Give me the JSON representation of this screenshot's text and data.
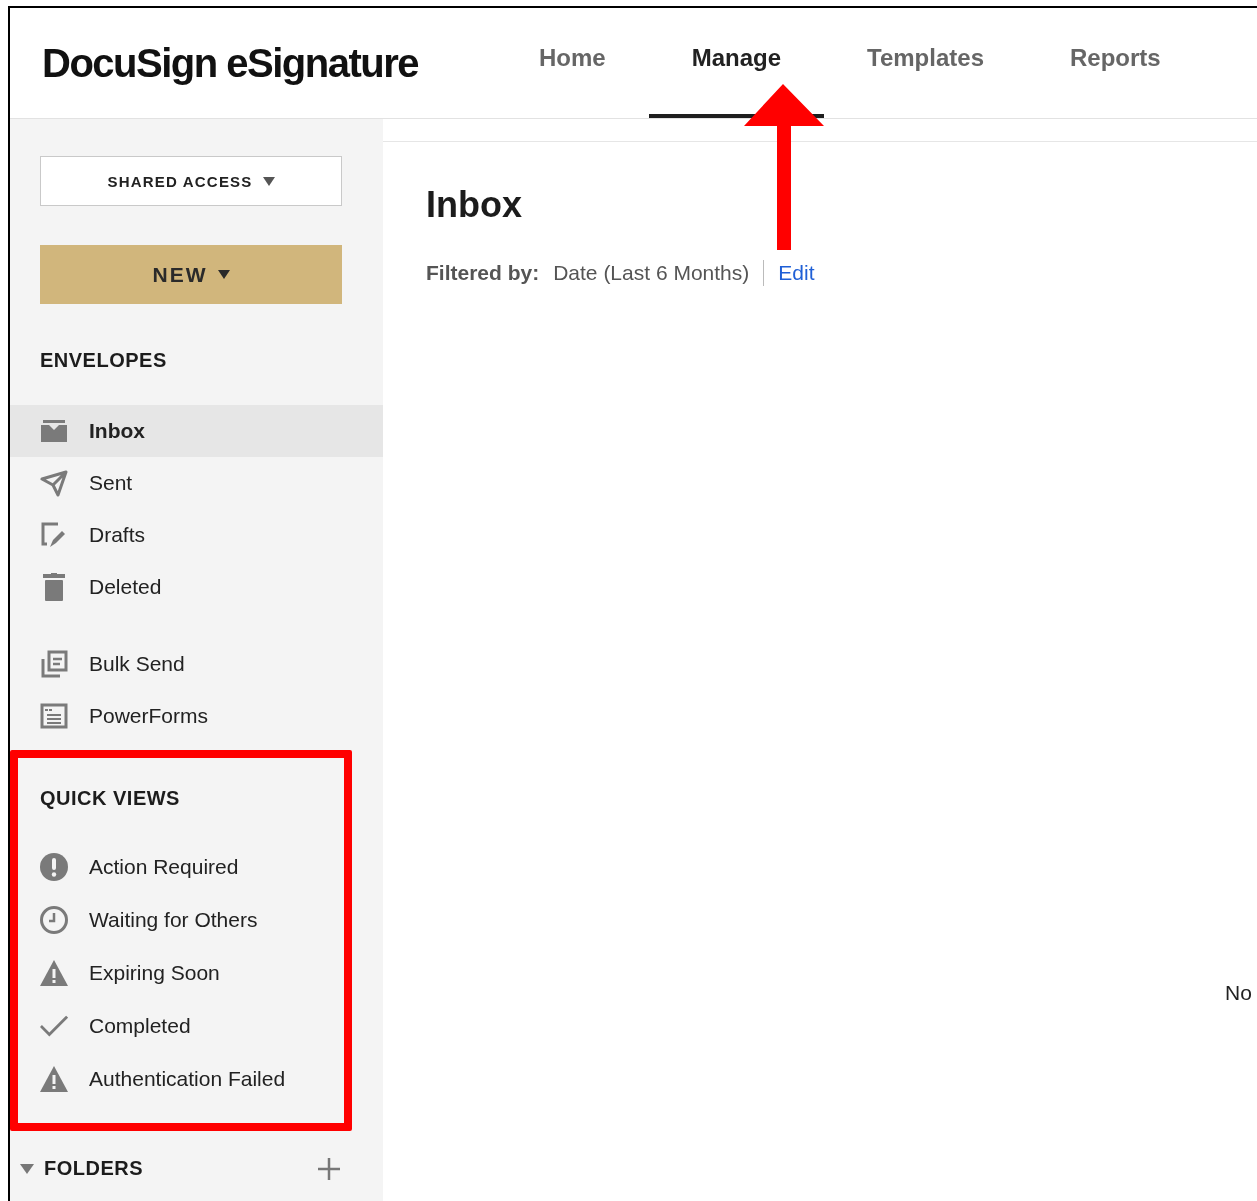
{
  "header": {
    "logo": "DocuSign eSignature",
    "tabs": [
      {
        "label": "Home",
        "selected": false
      },
      {
        "label": "Manage",
        "selected": true
      },
      {
        "label": "Templates",
        "selected": false
      },
      {
        "label": "Reports",
        "selected": false
      }
    ]
  },
  "annotation_arrow": true,
  "sidebar": {
    "shared_access": "SHARED ACCESS",
    "new_button": "NEW",
    "envelopes": {
      "heading": "ENVELOPES",
      "items": [
        {
          "label": "Inbox",
          "kind": "inbox",
          "selected": true
        },
        {
          "label": "Sent",
          "kind": "sent",
          "selected": false
        },
        {
          "label": "Drafts",
          "kind": "drafts",
          "selected": false
        },
        {
          "label": "Deleted",
          "kind": "trash",
          "selected": false
        }
      ],
      "tools": [
        {
          "label": "Bulk Send",
          "kind": "bulk",
          "selected": false
        },
        {
          "label": "PowerForms",
          "kind": "form",
          "selected": false
        }
      ]
    },
    "quick_views": {
      "heading": "QUICK VIEWS",
      "highlighted": true,
      "items": [
        {
          "label": "Action Required",
          "kind": "alert"
        },
        {
          "label": "Waiting for Others",
          "kind": "clock"
        },
        {
          "label": "Expiring Soon",
          "kind": "warning"
        },
        {
          "label": "Completed",
          "kind": "check"
        },
        {
          "label": "Authentication Failed",
          "kind": "warning"
        }
      ]
    },
    "folders": {
      "heading": "FOLDERS",
      "expanded": true
    }
  },
  "main": {
    "title": "Inbox",
    "filter_label": "Filtered by:",
    "filter_value": "Date (Last 6 Months)",
    "edit_link": "Edit",
    "message": "No"
  }
}
